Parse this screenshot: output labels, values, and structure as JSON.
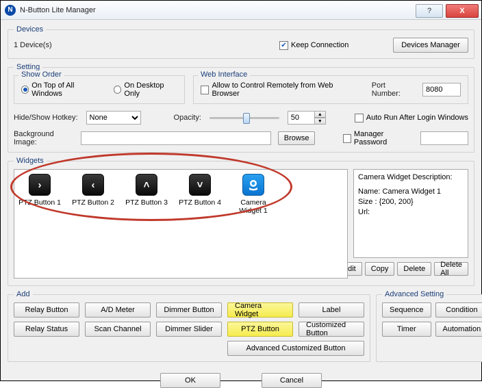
{
  "window": {
    "title": "N-Button Lite Manager",
    "help_glyph": "?",
    "close_glyph": "X"
  },
  "devices": {
    "legend": "Devices",
    "count_text": "1 Device(s)",
    "keep_connection_label": "Keep Connection",
    "keep_connection_checked": true,
    "manager_button": "Devices Manager"
  },
  "setting": {
    "legend": "Setting",
    "show_order": {
      "legend": "Show Order",
      "opt_all": "On Top of All Windows",
      "opt_desktop": "On Desktop Only",
      "selected": "all"
    },
    "web_interface": {
      "legend": "Web Interface",
      "allow_label": "Allow to Control Remotely from Web Browser",
      "allow_checked": false,
      "port_label": "Port Number:",
      "port_value": "8080"
    },
    "hotkey_label": "Hide/Show Hotkey:",
    "hotkey_value": "None",
    "opacity_label": "Opacity:",
    "opacity_value": "50",
    "autorun_label": "Auto Run After Login Windows",
    "autorun_checked": false,
    "bg_label": "Background Image:",
    "bg_value": "",
    "browse_btn": "Browse",
    "mgr_pwd_label": "Manager Password",
    "mgr_pwd_checked": false,
    "mgr_pwd_value": ""
  },
  "widgets": {
    "legend": "Widgets",
    "items": [
      {
        "label": "PTZ Button 1",
        "icon": "ptz-right"
      },
      {
        "label": "PTZ Button 2",
        "icon": "ptz-left"
      },
      {
        "label": "PTZ Button 3",
        "icon": "ptz-up"
      },
      {
        "label": "PTZ Button 4",
        "icon": "ptz-down"
      },
      {
        "label": "Camera Widget 1",
        "icon": "camera"
      }
    ],
    "desc": {
      "title": "Camera Widget Description:",
      "line1": "Name: Camera Widget 1",
      "line2": "Size : {200, 200}",
      "line3": "Url:"
    },
    "edit": "Edit",
    "copy": "Copy",
    "delete": "Delete",
    "delete_all": "Delete All"
  },
  "add": {
    "legend": "Add",
    "buttons": {
      "relay_button": "Relay Button",
      "ad_meter": "A/D Meter",
      "dimmer_button": "Dimmer Button",
      "camera_widget": "Camera Widget",
      "label": "Label",
      "relay_status": "Relay Status",
      "scan_channel": "Scan Channel",
      "dimmer_slider": "Dimmer Slider",
      "ptz_button": "PTZ Button",
      "custom_button": "Customized Button",
      "adv_custom": "Advanced Customized Button"
    }
  },
  "advanced": {
    "legend": "Advanced Setting",
    "sequence": "Sequence",
    "condition": "Condition",
    "timer": "Timer",
    "automation": "Automation"
  },
  "footer": {
    "ok": "OK",
    "cancel": "Cancel"
  }
}
